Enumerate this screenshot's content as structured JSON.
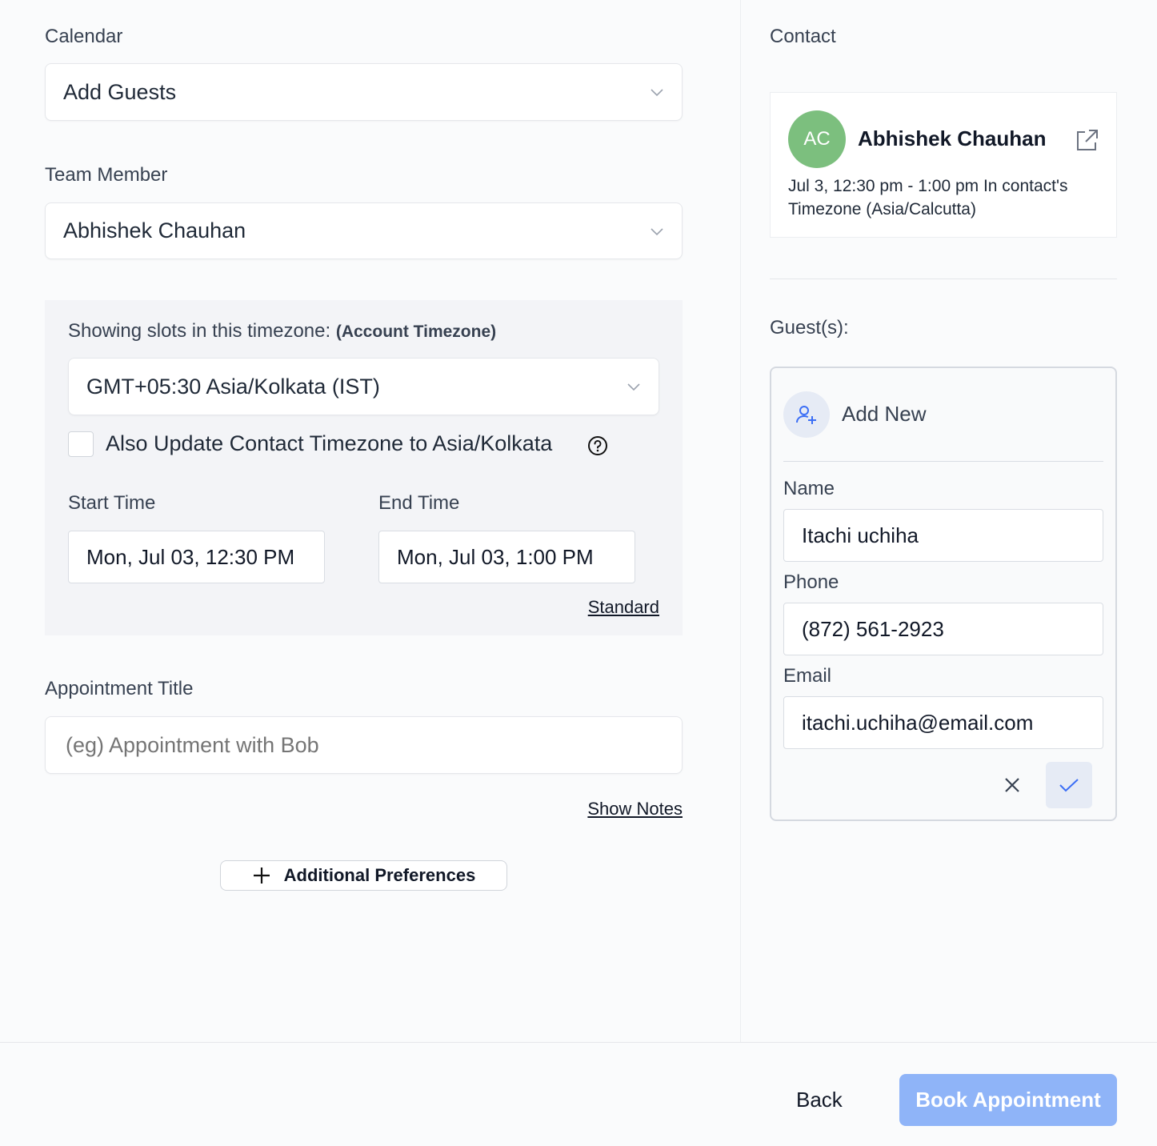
{
  "calendar": {
    "label": "Calendar",
    "value": "Add Guests"
  },
  "team_member": {
    "label": "Team Member",
    "value": "Abhishek Chauhan"
  },
  "timezone_panel": {
    "label": "Showing slots in this timezone:",
    "label_bold": "(Account Timezone)",
    "value": "GMT+05:30 Asia/Kolkata (IST)",
    "checkbox_label": "Also Update Contact Timezone to Asia/Kolkata",
    "start_label": "Start Time",
    "start_value": "Mon, Jul 03, 12:30 PM",
    "end_label": "End Time",
    "end_value": "Mon, Jul 03, 1:00 PM",
    "standard_link": "Standard"
  },
  "appointment": {
    "label": "Appointment Title",
    "placeholder": "(eg) Appointment with Bob",
    "show_notes": "Show Notes",
    "additional_prefs": "Additional Preferences"
  },
  "contact": {
    "section_label": "Contact",
    "initials": "AC",
    "name": "Abhishek Chauhan",
    "line1": "Jul 3, 12:30 pm - 1:00 pm In contact's",
    "line2": "Timezone (Asia/Calcutta)",
    "avatar_color": "#7cbf7e"
  },
  "guests": {
    "section_label": "Guest(s):",
    "add_new": "Add New",
    "name_label": "Name",
    "name_value": "Itachi uchiha",
    "phone_label": "Phone",
    "phone_value": "(872) 561-2923",
    "email_label": "Email",
    "email_value": "itachi.uchiha@email.com"
  },
  "footer": {
    "back": "Back",
    "book": "Book Appointment",
    "book_color": "#8fb4f8"
  }
}
